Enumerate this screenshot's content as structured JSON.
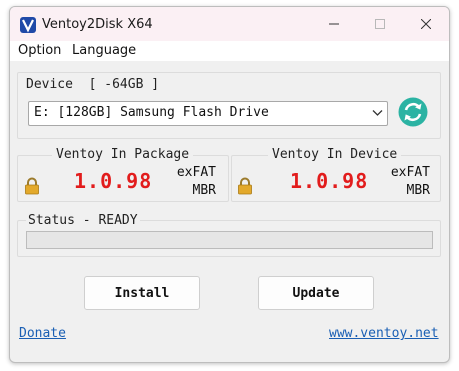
{
  "window": {
    "title": "Ventoy2Disk  X64"
  },
  "menu": {
    "items": [
      "Option",
      "Language"
    ]
  },
  "device": {
    "label": "Device  [ -64GB ]",
    "selected": "E: [128GB] Samsung Flash Drive"
  },
  "package": {
    "title": "Ventoy In Package",
    "version": "1.0.98",
    "fs": "exFAT",
    "part": "MBR"
  },
  "installed": {
    "title": "Ventoy In Device",
    "version": "1.0.98",
    "fs": "exFAT",
    "part": "MBR"
  },
  "status": {
    "text": "Status - READY",
    "progress": 0
  },
  "buttons": {
    "install": "Install",
    "update": "Update"
  },
  "links": {
    "donate": "Donate",
    "website": "www.ventoy.net"
  },
  "colors": {
    "version": "#e21c1c",
    "accent": "#1a5fb4",
    "refresh": "#2bb3a3"
  }
}
